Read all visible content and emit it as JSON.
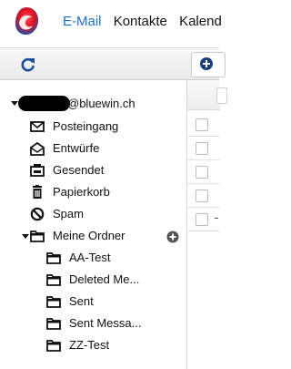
{
  "nav": {
    "email": "E-Mail",
    "contacts": "Kontakte",
    "calendar": "Kalend"
  },
  "account": {
    "email_suffix": "@bluewin.ch"
  },
  "folders": {
    "inbox": "Posteingang",
    "drafts": "Entwürfe",
    "sent": "Gesendet",
    "trash": "Papierkorb",
    "spam": "Spam",
    "my_folders": "Meine Ordner",
    "sub": {
      "aa_test": "AA-Test",
      "deleted": "Deleted Me...",
      "sent": "Sent",
      "sent_messages": "Sent Messa...",
      "zz_test": "ZZ-Test"
    }
  },
  "colors": {
    "accent": "#1a73c8",
    "brand_red": "#e3111d",
    "brand_blue": "#1f4ea8"
  }
}
